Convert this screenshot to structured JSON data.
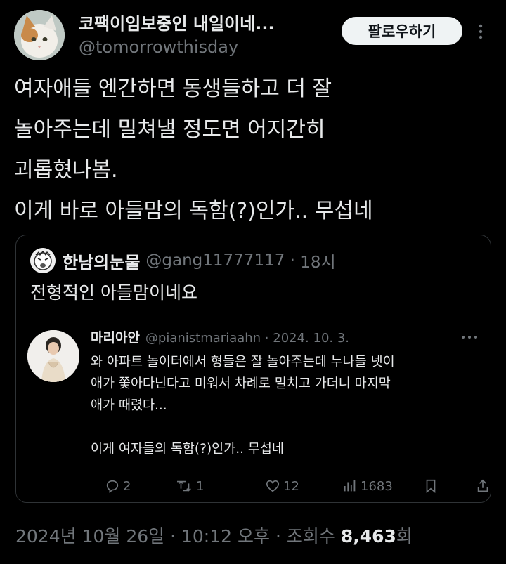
{
  "author": {
    "display_name": "코팩이임보중인 내일이네...",
    "handle": "@tomorrowthisday",
    "avatar_icon": "cat-avatar-icon"
  },
  "follow_label": "팔로우하기",
  "tweet": {
    "lines": [
      "여자애들 엔간하면 동생들하고 더 잘",
      "놀아주는데 밀쳐낼 정도면 어지간히",
      "괴롭혔나봄.",
      "이게 바로 아들맘의 독함(?)인가.. 무섭네"
    ]
  },
  "quote": {
    "name": "한남의눈물",
    "handle": "@gang11777117",
    "time": "18시",
    "text": "전형적인 아들맘이네요",
    "inner": {
      "name": "마리아안",
      "handle": "@pianistmariaahn",
      "date": "2024. 10. 3.",
      "lines": [
        "와 아파트 놀이터에서 형들은 잘 놀아주는데 누나들 넷이",
        "애가 쫓아다닌다고 미워서 차례로 밀치고 가더니 마지막",
        "애가 때렸다...",
        "",
        "이게 여자들의 독함(?)인가.. 무섭네"
      ],
      "stats": {
        "replies": "2",
        "retweets": "1",
        "likes": "12",
        "views": "1683"
      }
    }
  },
  "footer": {
    "date": "2024년 10월 26일",
    "time": "10:12 오후",
    "views_label": "조회수",
    "views_count": "8,463",
    "views_suffix": "회"
  },
  "colors": {
    "background": "#000000",
    "text": "#e7e9ea",
    "muted": "#71767b",
    "border": "#2f3336"
  }
}
